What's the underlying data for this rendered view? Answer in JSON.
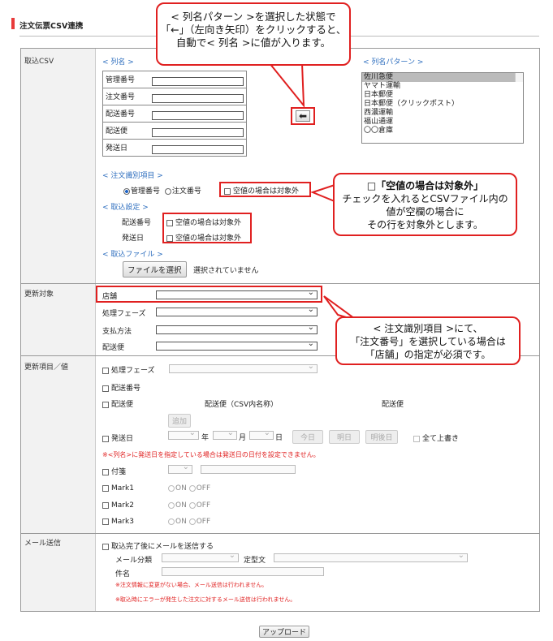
{
  "header": {
    "title": "注文伝票CSV連携"
  },
  "sections": {
    "import": "取込CSV",
    "update_target": "更新対象",
    "update_fields": "更新項目／値",
    "mail": "メール送信"
  },
  "import": {
    "column_link": "< 列名 >",
    "pattern_link": "< 列名パターン >",
    "columns": [
      "管理番号",
      "注文番号",
      "配送番号",
      "配送便",
      "発送日"
    ],
    "patterns": [
      "佐川急便",
      "ヤマト運輸",
      "日本郵便",
      "日本郵便（クリックポスト）",
      "西濃運輸",
      "福山通運",
      "〇〇倉庫"
    ],
    "identify_link": "< 注文識別項目 >",
    "radio_mgmt": "管理番号",
    "radio_order": "注文番号",
    "empty_exclude": "空値の場合は対象外",
    "settings_link": "< 取込設定 >",
    "setting_ship_no": "配送番号",
    "setting_ship_date": "発送日",
    "file_link": "< 取込ファイル >",
    "file_button": "ファイルを選択",
    "file_status": "選択されていません"
  },
  "update_target": {
    "fields": [
      "店舗",
      "処理フェーズ",
      "支払方法",
      "配送便"
    ]
  },
  "update_fields": {
    "phase": "処理フェーズ",
    "ship_no": "配送番号",
    "carrier": "配送便",
    "carrier_csv": "配送便（CSV内名称）",
    "carrier_right": "配送便",
    "add_button": "追加",
    "ship_date": "発送日",
    "year": "年",
    "month": "月",
    "day": "日",
    "today": "今日",
    "tomorrow": "明日",
    "day_after": "明後日",
    "overwrite_all": "全て上書き",
    "date_note": "※<列名>に発送日を指定している場合は発送日の日付を設定できません。",
    "tag": "付箋",
    "marks": [
      "Mark1",
      "Mark2",
      "Mark3"
    ],
    "on": "ON",
    "off": "OFF"
  },
  "mail": {
    "send_after": "取込完了後にメールを送信する",
    "category": "メール分類",
    "template": "定型文",
    "subject": "件名",
    "note1": "※注文情報に変更がない場合、メール送信は行われません。",
    "note2": "※取込時にエラーが発生した注文に対するメール送信は行われません。"
  },
  "upload_button": "アップロード",
  "callouts": {
    "arrow_lines": [
      "< 列名パターン >を選択した状態で",
      "「←」（左向き矢印）をクリックすると、",
      "自動で< 列名 >に値が入ります。"
    ],
    "empty_title": "□「空値の場合は対象外」",
    "empty_lines": [
      "チェックを入れるとCSVファイル内の",
      "値が空欄の場合に",
      "その行を対象外とします。"
    ],
    "store_lines": [
      "< 注文識別項目 >にて、",
      "「注文番号」を選択している場合は",
      "「店舗」の指定が必須です。"
    ]
  },
  "colors": {
    "accent_red": "#e02020",
    "link_blue": "#2f6fbf"
  }
}
